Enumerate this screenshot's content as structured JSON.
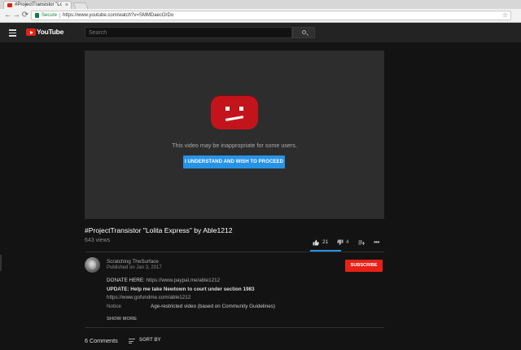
{
  "browser": {
    "tab_title": "#ProjectTransistor \"Lolit",
    "tab_close": "×",
    "secure_label": "Secure",
    "url": "https://www.youtube.com/watch?v=SMMDaecOrDo",
    "back": "←",
    "forward": "→",
    "reload": "⟳",
    "bookmark": "☆"
  },
  "masthead": {
    "logo_text": "YouTube",
    "search_placeholder": "Search"
  },
  "player": {
    "message": "This video may be inappropriate for some users.",
    "proceed_label": "I UNDERSTAND AND WISH TO PROCEED"
  },
  "video": {
    "title": "#ProjectTransistor \"Lolita Express\" by Able1212",
    "views": "643 views",
    "likes": "21",
    "dislikes": "4",
    "more": "•••"
  },
  "owner": {
    "channel": "Scratching TheSurface",
    "published": "Published on Jan 3, 2017",
    "subscribe_label": "SUBSCRIBE"
  },
  "description": {
    "donate_label": "DONATE HERE:",
    "donate_link": "https://www.paypal.me/able1212",
    "update_line": "UPDATE: Help me take Newtown to court under section 1983",
    "gofundme_link": "https://www.gofundme.com/able1212",
    "notice_label": "Notice",
    "notice_value": "Age-restricted video (based on Community Guidelines)",
    "show_more": "SHOW MORE"
  },
  "comments": {
    "count_label": "6 Comments",
    "sort_label": "SORT BY"
  },
  "colors": {
    "youtube_red": "#e62117",
    "accent_blue": "#2793e6",
    "background": "#131313"
  }
}
